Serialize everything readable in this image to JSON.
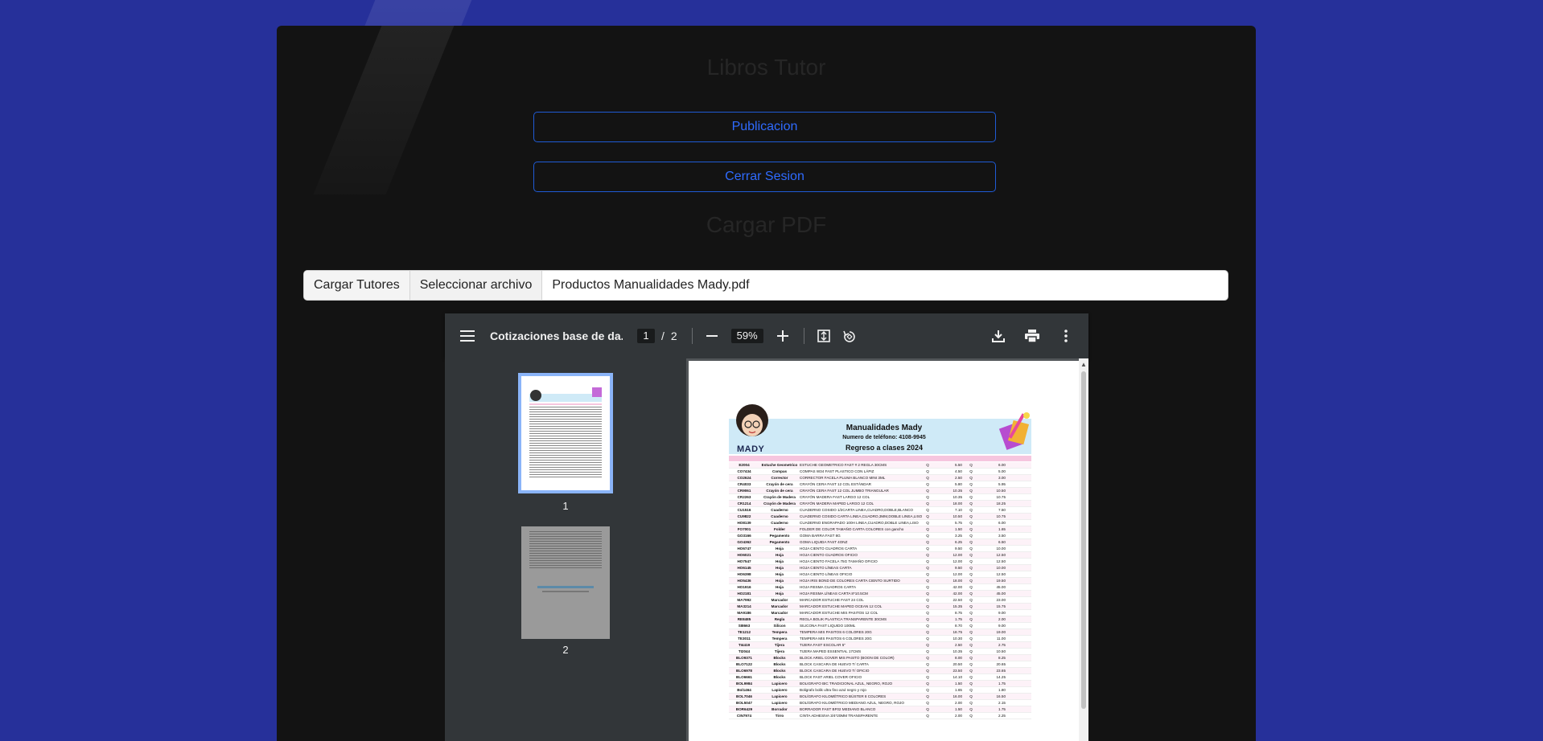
{
  "app": {
    "title": "Libros Tutor",
    "publish_label": "Publicacion",
    "logout_label": "Cerrar Sesion",
    "section_title": "Cargar PDF"
  },
  "file_input": {
    "label": "Cargar Tutores",
    "button": "Seleccionar archivo",
    "filename": "Productos Manualidades Mady.pdf"
  },
  "pdf_viewer": {
    "doc_title": "Cotizaciones base de da...",
    "current_page": "1",
    "separator": "/",
    "total_pages": "2",
    "zoom": "59%",
    "thumbnails": [
      {
        "label": "1"
      },
      {
        "label": "2"
      }
    ]
  },
  "pdf_page": {
    "store_name": "Manualidades Mady",
    "phone": "Numero de teléfono: 4108-9945",
    "subtitle": "Regreso a clases 2024",
    "logo_text": "MADY",
    "rows": [
      [
        "E2004",
        "Estuche Geometrico",
        "ESTUCHE GEOMETRICO FAST # 2 REGLA 30CMS",
        "Q",
        "5.50",
        "Q",
        "6.00"
      ],
      [
        "CO7434",
        "Compas",
        "COMPAS W34 FAST PLASTICO CON LÁPIZ",
        "Q",
        "4.50",
        "Q",
        "5.00"
      ],
      [
        "CO2624",
        "Corrector",
        "CORRECTOR FACELA PLUMA BLANCO MINI 3ML",
        "Q",
        "2.50",
        "Q",
        "3.00"
      ],
      [
        "CR4033",
        "Crayón de cera",
        "CRAYÓN CERA FAST 12 COL ESTÁNDAR",
        "Q",
        "5.80",
        "Q",
        "5.95"
      ],
      [
        "CR9061",
        "Crayón de cera",
        "CRAYÓN CERA FAST 12 COL JUMBO TRIANGULAR",
        "Q",
        "10.35",
        "Q",
        "10.50"
      ],
      [
        "CR2263",
        "Crayón de Madera",
        "CRAYÓN MADERA FAST LARGO 12 COL",
        "Q",
        "10.35",
        "Q",
        "10.75"
      ],
      [
        "CR1214",
        "Crayón de Madera",
        "CRAYÓN MADERA MAPED LARGO 12 COL",
        "Q",
        "18.00",
        "Q",
        "18.25"
      ],
      [
        "CU1516",
        "Cuaderno",
        "CUADERNO COSIDO 1/2CARTA LINEA,CUADRO,DOBLE,BLANCO",
        "Q",
        "7.10",
        "Q",
        "7.50"
      ],
      [
        "CU9822",
        "Cuaderno",
        "CUADERNO COSIDO CARTA LINEA,CUADRO,3MM,DOBLE LINEA,LISO",
        "Q",
        "10.50",
        "Q",
        "10.75"
      ],
      [
        "HO8139",
        "Cuaderno",
        "CUADERNO ENGRAPADO 100H LINEA,CUADRO,DOBLE LINEA,LISO",
        "Q",
        "5.75",
        "Q",
        "6.00"
      ],
      [
        "FO7001",
        "Folder",
        "FOLDER DE COLOR TAMAÑO CARTA COLORES con gancho",
        "Q",
        "1.50",
        "Q",
        "1.65"
      ],
      [
        "GO3166",
        "Pegamento",
        "GOMA BARRA FAST 8G",
        "Q",
        "3.25",
        "Q",
        "3.50"
      ],
      [
        "GO4362",
        "Pegamento",
        "GOMA LIQUIDA FAST 4ONZ",
        "Q",
        "6.25",
        "Q",
        "6.50"
      ],
      [
        "HO6747",
        "Hoja",
        "HOJA CIENTO CUADROS CARTA",
        "Q",
        "9.50",
        "Q",
        "10.00"
      ],
      [
        "HO6021",
        "Hoja",
        "HOJA CIENTO CUADROS OFICIO",
        "Q",
        "12.00",
        "Q",
        "12.50"
      ],
      [
        "HO7547",
        "Hoja",
        "HOJA CIENTO FACELA 75G TAMAÑO OFICIO",
        "Q",
        "12.00",
        "Q",
        "12.50"
      ],
      [
        "HO6145",
        "Hoja",
        "HOJA CIENTO LÍNEAS CARTA",
        "Q",
        "9.50",
        "Q",
        "10.00"
      ],
      [
        "HO6398",
        "Hoja",
        "HOJA CIENTO LÍNEAS OFICIO",
        "Q",
        "12.00",
        "Q",
        "12.50"
      ],
      [
        "HO5436",
        "Hoja",
        "HOJA IRIS BOND DE COLORES CARTA CIENTO SURTIDO",
        "Q",
        "18.00",
        "Q",
        "19.50"
      ],
      [
        "HO1916",
        "Hoja",
        "HOJA RESMA CUADROS CARTA",
        "Q",
        "42.00",
        "Q",
        "45.00"
      ],
      [
        "HO2181",
        "Hoja",
        "HOJA RESMA LÍNEAS CARTA 8*10.5CM",
        "Q",
        "42.00",
        "Q",
        "45.00"
      ],
      [
        "MA7992",
        "Marcador",
        "MARCADOR ESTUCHE FAST 24 COL",
        "Q",
        "22.50",
        "Q",
        "23.00"
      ],
      [
        "MA3214",
        "Marcador",
        "MARCADOR ESTUCHE MAPED OCEAN 12 COL",
        "Q",
        "15.35",
        "Q",
        "15.75"
      ],
      [
        "MA9186",
        "Marcador",
        "MARCADOR ESTUCHE MIS PASITOS 12 COL",
        "Q",
        "8.75",
        "Q",
        "9.00"
      ],
      [
        "RE8485",
        "Regla",
        "REGLA BOLIK PLASTICA TRANSPARENTE 30CMS",
        "Q",
        "1.75",
        "Q",
        "2.00"
      ],
      [
        "SI8663",
        "Silicon",
        "SILICONA FAST LIQUIDO 100ML",
        "Q",
        "8.70",
        "Q",
        "9.00"
      ],
      [
        "TE1212",
        "Tempera",
        "TEMPERA MIS PASITOS 6 COLORES 20G",
        "Q",
        "18.75",
        "Q",
        "19.00"
      ],
      [
        "TE3011",
        "Tempera",
        "TEMPERA MIS PASITOS 6 COLORES 20G",
        "Q",
        "10.30",
        "Q",
        "11.00"
      ],
      [
        "TI4419",
        "Tijera",
        "TIJERA FAST ESCOLAR 5\"",
        "Q",
        "2.50",
        "Q",
        "2.75"
      ],
      [
        "TI2044",
        "Tijera",
        "TIJERA MAPED ESSENTIAL 17CMS",
        "Q",
        "10.35",
        "Q",
        "10.50"
      ],
      [
        "BLO9371",
        "Blocks",
        "BLOCK ARIEL COVER MIS PASITO (BOON DE COLOR)",
        "Q",
        "8.00",
        "Q",
        "8.25"
      ],
      [
        "BLO7122",
        "Blocks",
        "BLOCK CASCARA DE HUEVO T/ CARTA",
        "Q",
        "20.50",
        "Q",
        "20.65"
      ],
      [
        "BLO6978",
        "Blocks",
        "BLOCK CASCARA DE HUEVO T/ OFICIO",
        "Q",
        "23.50",
        "Q",
        "23.65"
      ],
      [
        "BLO6661",
        "Blocks",
        "BLOCK FAST ARIEL COVER OFICIO",
        "Q",
        "14.10",
        "Q",
        "14.25"
      ],
      [
        "BOL9984",
        "Lapicero",
        "BOLIGRAFO BIC TRADICIONAL AZUL, NEGRO, ROJO",
        "Q",
        "1.50",
        "Q",
        "1.75"
      ],
      [
        "Bol1464",
        "Lapicero",
        "Boligrafo bolik ultra fino azul negro y rojo",
        "Q",
        "1.65",
        "Q",
        "1.80"
      ],
      [
        "BOL7046",
        "Lapicero",
        "BOLÍGRAFO KILOMÉTRICO BÚSTER 8 COLORES",
        "Q",
        "16.00",
        "Q",
        "16.50"
      ],
      [
        "BOL5047",
        "Lapicero",
        "BOLÍGRAFO KILOMÉTRICO MEDIANO AZUL, NEGRO, ROJO",
        "Q",
        "2.00",
        "Q",
        "2.15"
      ],
      [
        "BOR6429",
        "Borrador",
        "BORRADOR FAST BF02 MEDIANO BLANCO",
        "Q",
        "1.50",
        "Q",
        "1.75"
      ],
      [
        "CIN7974",
        "Tirro",
        "CINTA ADHESIVA 3/4*20MM TRANSPARENTE",
        "Q",
        "2.00",
        "Q",
        "2.25"
      ]
    ]
  }
}
